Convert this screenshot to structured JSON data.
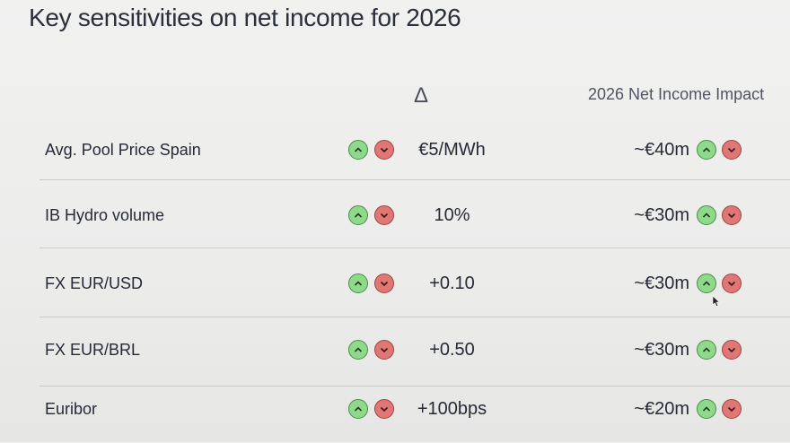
{
  "title": "Key sensitivities on net income for 2026",
  "headers": {
    "delta": "Δ",
    "impact": "2026 Net Income Impact"
  },
  "rows": [
    {
      "label": "Avg. Pool Price Spain",
      "delta": "€5/MWh",
      "impact": "~€40m"
    },
    {
      "label": "IB Hydro volume",
      "delta": "10%",
      "impact": "~€30m"
    },
    {
      "label": "FX EUR/USD",
      "delta": "+0.10",
      "impact": "~€30m"
    },
    {
      "label": "FX EUR/BRL",
      "delta": "+0.50",
      "impact": "~€30m"
    },
    {
      "label": "Euribor",
      "delta": "+100bps",
      "impact": "~€20m"
    }
  ],
  "icons": {
    "up": "chevron-up-icon",
    "down": "chevron-down-icon",
    "cursor": "mouse-pointer-icon"
  },
  "colors": {
    "up_fill": "#8fd98a",
    "down_fill": "#e07775",
    "text": "#262a36"
  }
}
